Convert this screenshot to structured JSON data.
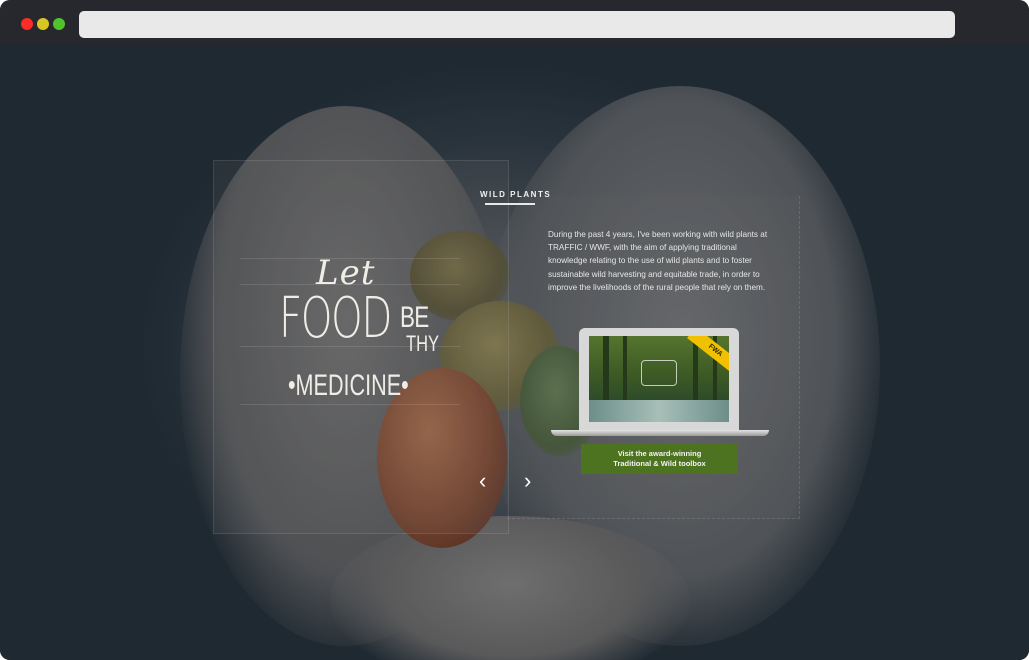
{
  "browser": {
    "controls": [
      "close",
      "minimize",
      "maximize"
    ],
    "address_bar_text": ""
  },
  "hero": {
    "logo": {
      "line1": "Let",
      "line2": "FOOD",
      "line3a": "BE",
      "line3b": "THY",
      "line4": "•MEDICINE•"
    },
    "section_label": "WILD PLANTS",
    "paragraph": "During the past 4 years, I've been working with wild plants at TRAFFIC / WWF, with the aim of applying traditional knowledge relating to the use of wild plants and to foster sustainable wild harvesting and equitable trade, in order to improve the livelihoods of the rural people that rely on them.",
    "laptop_ribbon": "FWA",
    "cta_line1": "Visit the award-winning",
    "cta_line2": "Traditional & Wild toolbox",
    "prev_arrow": "‹",
    "next_arrow": "›"
  },
  "colors": {
    "cta_background": "#4e7320",
    "chrome": "#26282e",
    "dot_red": "#fe2b26",
    "dot_yellow": "#d9c621",
    "dot_green": "#52c22c"
  }
}
